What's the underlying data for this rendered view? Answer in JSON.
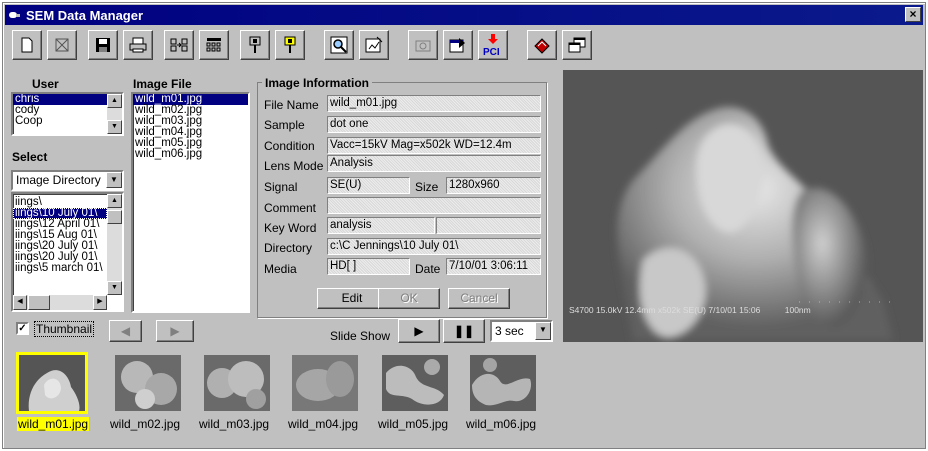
{
  "window": {
    "title": "SEM Data Manager",
    "close_glyph": "×"
  },
  "toolbar": {
    "buttons": [
      {
        "name": "new-doc-icon"
      },
      {
        "name": "clear-icon"
      },
      {
        "name": "save-icon"
      },
      {
        "name": "print-icon"
      },
      {
        "name": "arrange-icon"
      },
      {
        "name": "grid-icon"
      },
      {
        "name": "pin-icon"
      },
      {
        "name": "pin-yellow-icon"
      },
      {
        "name": "zoom-icon"
      },
      {
        "name": "edit-image-icon"
      },
      {
        "name": "camera-icon"
      },
      {
        "name": "export-icon"
      },
      {
        "name": "pci-icon",
        "label": "PCI"
      },
      {
        "name": "book-icon"
      },
      {
        "name": "windows-icon"
      }
    ]
  },
  "user": {
    "label": "User",
    "items": [
      "chris",
      "cody",
      "Coop"
    ],
    "selected": "chris"
  },
  "select": {
    "label": "Select",
    "combo_value": "Image Directory",
    "dirs": [
      "iings\\",
      "iings\\10 July 01\\",
      "iings\\12 April 01\\",
      "iings\\15 Aug 01\\",
      "iings\\20 July 01\\",
      "iings\\20 July 01\\",
      "iings\\5 march 01\\"
    ]
  },
  "image_file": {
    "label": "Image File",
    "files": [
      "wild_m01.jpg",
      "wild_m02.jpg",
      "wild_m03.jpg",
      "wild_m04.jpg",
      "wild_m05.jpg",
      "wild_m06.jpg"
    ],
    "selected": "wild_m01.jpg"
  },
  "info": {
    "title": "Image Information",
    "file_name": {
      "label": "File Name",
      "value": "wild_m01.jpg"
    },
    "sample": {
      "label": "Sample",
      "value": "dot one"
    },
    "condition": {
      "label": "Condition",
      "value": "Vacc=15kV   Mag=x502k   WD=12.4m"
    },
    "lens_mode": {
      "label": "Lens Mode",
      "value": "Analysis"
    },
    "signal": {
      "label": "Signal",
      "value": "SE(U)"
    },
    "size": {
      "label": "Size",
      "value": "1280x960"
    },
    "comment": {
      "label": "Comment",
      "value": ""
    },
    "key_word": {
      "label": "Key Word",
      "value": "analysis"
    },
    "directory": {
      "label": "Directory",
      "value": "c:\\C Jennings\\10 July 01\\"
    },
    "media": {
      "label": "Media",
      "value": "HD[ ]"
    },
    "date": {
      "label": "Date",
      "value": "7/10/01 3:06:11"
    },
    "buttons": {
      "edit": "Edit",
      "ok": "OK",
      "cancel": "Cancel"
    }
  },
  "preview": {
    "caption": "S4700 15.0kV 12.4mm x502k SE(U) 7/10/01 15:06",
    "scale": "100nm"
  },
  "thumbnail_toggle": {
    "label": "Thumbnail",
    "checked": true
  },
  "slideshow": {
    "label": "Slide Show",
    "interval": "3 sec"
  },
  "thumbnails": [
    {
      "label": "wild_m01.jpg",
      "selected": true
    },
    {
      "label": "wild_m02.jpg",
      "selected": false
    },
    {
      "label": "wild_m03.jpg",
      "selected": false
    },
    {
      "label": "wild_m04.jpg",
      "selected": false
    },
    {
      "label": "wild_m05.jpg",
      "selected": false
    },
    {
      "label": "wild_m06.jpg",
      "selected": false
    }
  ],
  "colors": {
    "titlebar": "#000080",
    "selection": "#000080",
    "thumb_highlight": "#ffff00",
    "face": "#c0c0c0"
  }
}
